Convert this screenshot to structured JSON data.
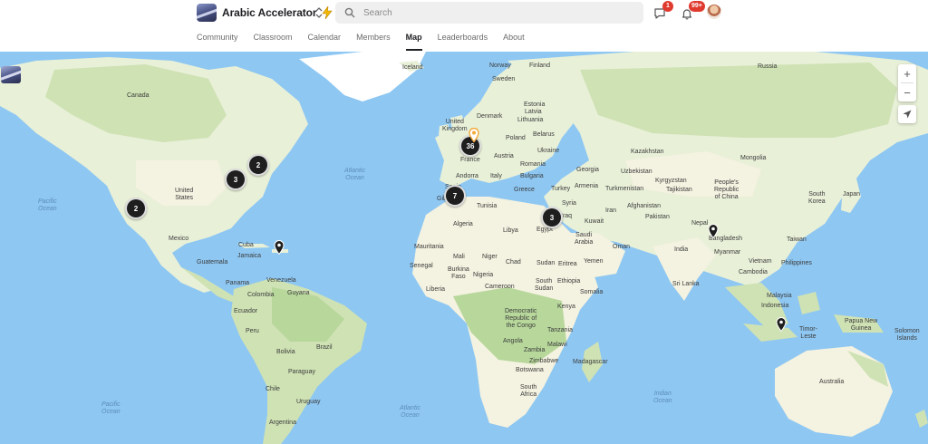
{
  "header": {
    "community_name": "Arabic Accelerator",
    "search_placeholder": "Search",
    "chat_badge": "1",
    "notifications_badge": "99+"
  },
  "nav": {
    "tabs": [
      {
        "label": "Community"
      },
      {
        "label": "Classroom"
      },
      {
        "label": "Calendar"
      },
      {
        "label": "Members"
      },
      {
        "label": "Map"
      },
      {
        "label": "Leaderboards"
      },
      {
        "label": "About"
      }
    ],
    "active_tab": "Map"
  },
  "map": {
    "zoom_in_label": "+",
    "zoom_out_label": "−",
    "labels": {
      "russia": "Russia",
      "canada": "Canada",
      "iceland": "Iceland",
      "norway": "Norway",
      "finland": "Finland",
      "sweden": "Sweden",
      "estonia": "Estonia",
      "latvia": "Latvia",
      "lithuania": "Lithuania",
      "denmark": "Denmark",
      "united_kingdom": "United\nKingdom",
      "poland": "Poland",
      "belarus": "Belarus",
      "ukraine": "Ukraine",
      "kazakhstan": "Kazakhstan",
      "mongolia": "Mongolia",
      "france": "France",
      "austria": "Austria",
      "romania": "Romania",
      "andorra": "Andorra",
      "italy": "Italy",
      "bulgaria": "Bulgaria",
      "georgia": "Georgia",
      "uzbekistan": "Uzbekistan",
      "kyrgyzstan": "Kyrgyzstan",
      "spain": "Spain",
      "greece": "Greece",
      "turkey": "Turkey",
      "armenia": "Armenia",
      "turkmenistan": "Turkmenistan",
      "tajikistan": "Tajikistan",
      "china": "People's\nRepublic\nof China",
      "south_korea": "South\nKorea",
      "japan": "Japan",
      "gibraltar": "Gibraltar",
      "tunisia": "Tunisia",
      "syria": "Syria",
      "iraq": "Iraq",
      "iran": "Iran",
      "afghanistan": "Afghanistan",
      "algeria": "Algeria",
      "libya": "Libya",
      "egypt": "Egypt",
      "kuwait": "Kuwait",
      "pakistan": "Pakistan",
      "saudi_arabia": "Saudi\nArabia",
      "nepal": "Nepal",
      "bangladesh": "Bangladesh",
      "taiwan": "Taiwan",
      "mauritania": "Mauritania",
      "mali": "Mali",
      "niger": "Niger",
      "chad": "Chad",
      "sudan": "Sudan",
      "eritrea": "Eritrea",
      "oman": "Oman",
      "yemen": "Yemen",
      "india": "India",
      "myanmar": "Myanmar",
      "vietnam": "Vietnam",
      "philippines": "Philippines",
      "senegal": "Senegal",
      "burkina_faso": "Burkina\nFaso",
      "nigeria": "Nigeria",
      "ethiopia": "Ethiopia",
      "somalia": "Somalia",
      "cambodia": "Cambodia",
      "sri_lanka": "Sri Lanka",
      "liberia": "Liberia",
      "cameroon": "Cameroon",
      "south_sudan": "South\nSudan",
      "malaysia": "Malaysia",
      "drc": "Democratic\nRepublic of\nthe Congo",
      "kenya": "Kenya",
      "indonesia": "Indonesia",
      "papua_new_guinea": "Papua New\nGuinea",
      "timor_leste": "Timor-\nLeste",
      "solomon_islands": "Solomon\nIslands",
      "tanzania": "Tanzania",
      "angola": "Angola",
      "malawi": "Malawi",
      "zambia": "Zambia",
      "zimbabwe": "Zimbabwe",
      "madagascar": "Madagascar",
      "botswana": "Botswana",
      "south_africa": "South\nAfrica",
      "australia": "Australia",
      "united_states": "United\nStates",
      "mexico": "Mexico",
      "cuba": "Cuba",
      "jamaica": "Jamaica",
      "guatemala": "Guatemala",
      "panama": "Panama",
      "venezuela": "Venezuela",
      "colombia": "Colombia",
      "guyana": "Guyana",
      "ecuador": "Ecuador",
      "peru": "Peru",
      "brazil": "Brazil",
      "bolivia": "Bolivia",
      "paraguay": "Paraguay",
      "chile": "Chile",
      "uruguay": "Uruguay",
      "argentina": "Argentina",
      "atlantic_ocean": "Atlantic\nOcean",
      "pacific_ocean_n": "Pacific\nOcean",
      "pacific_ocean_s": "Pacific\nOcean",
      "atlantic_ocean_s": "Atlantic\nOcean",
      "indian_ocean": "Indian\nOcean"
    },
    "clusters": [
      {
        "id": "europe",
        "count": "36"
      },
      {
        "id": "north-africa",
        "count": "7"
      },
      {
        "id": "middle-east",
        "count": "3"
      },
      {
        "id": "us-east",
        "count": "3"
      },
      {
        "id": "canada-east",
        "count": "2"
      },
      {
        "id": "us-west",
        "count": "2"
      }
    ]
  },
  "colors": {
    "ocean": "#8ec7f2",
    "land": "#eaf2d9",
    "forest": "#b9d8a0",
    "desert": "#f5f0dc",
    "cluster": "#1e1e1e",
    "badge": "#e03a2f",
    "highlight_pin": "#f2a93b"
  },
  "icons": {
    "search": "search-icon",
    "chat": "chat-icon",
    "bell": "bell-icon",
    "switcher": "chevron-updown-icon",
    "bolt": "lightning-bolt-icon",
    "locate": "locate-arrow-icon"
  }
}
